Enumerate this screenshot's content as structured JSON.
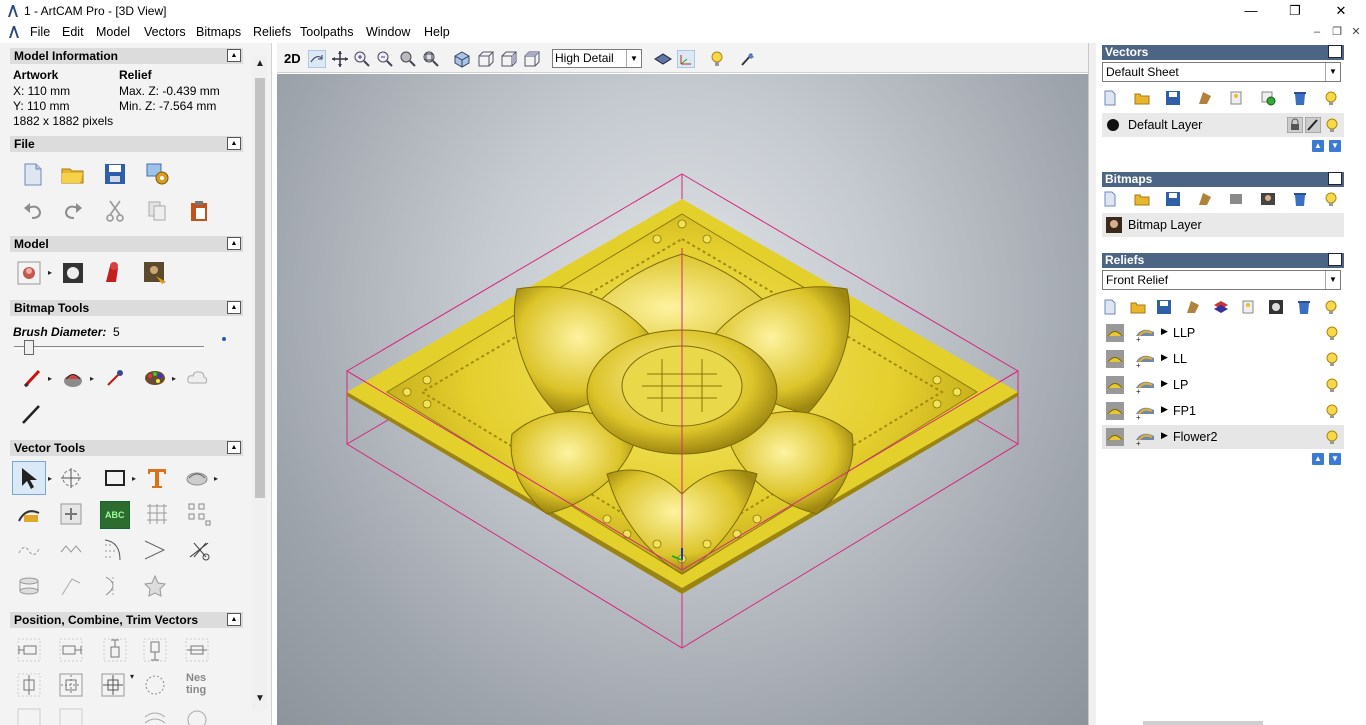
{
  "window": {
    "title": "1 - ArtCAM Pro - [3D View]",
    "minimize": "—",
    "restore": "❐",
    "close": "✕"
  },
  "menu": [
    "File",
    "Edit",
    "Model",
    "Vectors",
    "Bitmaps",
    "Reliefs",
    "Toolpaths",
    "Window",
    "Help"
  ],
  "mdi_controls": [
    "–",
    "❐",
    "✕"
  ],
  "left_panel": {
    "model_info": {
      "header": "Model Information",
      "artwork_label": "Artwork",
      "relief_label": "Relief",
      "x": "X: 110 mm",
      "y": "Y: 110 mm",
      "pixels": "1882 x 1882 pixels",
      "max_z": "Max. Z: -0.439 mm",
      "min_z": "Min. Z: -7.564 mm"
    },
    "file_header": "File",
    "model_header": "Model",
    "bitmap_tools": {
      "header": "Bitmap Tools",
      "brush_label": "Brush Diameter:",
      "brush_value": "5",
      "brush_fraction": 0.05
    },
    "vector_tools_header": "Vector Tools",
    "nesting_label_1": "Nes",
    "nesting_label_2": "ting",
    "abc_label": "ABC",
    "position_header": "Position, Combine, Trim Vectors"
  },
  "view_toolbar": {
    "mode_2d": "2D",
    "detail": "High Detail"
  },
  "vectors": {
    "header": "Vectors",
    "sheet": "Default Sheet",
    "layer": "Default Layer"
  },
  "bitmaps": {
    "header": "Bitmaps",
    "layer": "Bitmap Layer"
  },
  "reliefs": {
    "header": "Reliefs",
    "selected": "Front Relief",
    "layers": [
      {
        "name": "LLP"
      },
      {
        "name": "LL"
      },
      {
        "name": "LP"
      },
      {
        "name": "FP1"
      },
      {
        "name": "Flower2"
      }
    ]
  },
  "colors": {
    "relief_gold": "#e8d430",
    "box_magenta": "#d8277e",
    "panel_header": "#4d6585"
  }
}
